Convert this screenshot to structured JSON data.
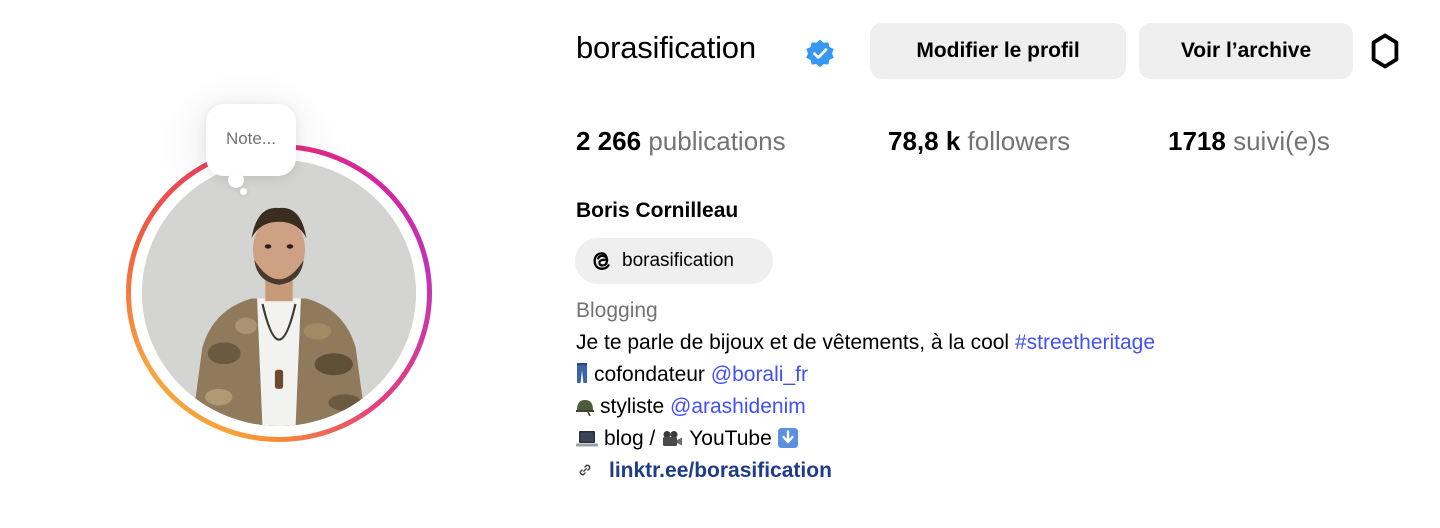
{
  "profile": {
    "username": "borasification",
    "verified": true,
    "note_placeholder": "Note...",
    "buttons": {
      "edit_profile": "Modifier le profil",
      "view_archive": "Voir l’archive"
    },
    "stats": {
      "posts_count": "2 266",
      "posts_label": "publications",
      "followers_count": "78,8 k",
      "followers_label": "followers",
      "following_count": "1718",
      "following_label": "suivi(e)s"
    },
    "full_name": "Boris Cornilleau",
    "threads_handle": "borasification",
    "category": "Blogging",
    "bio": {
      "line1_text": "Je te parle de bijoux et de vêtements, à la cool ",
      "line1_hashtag": "#streetheritage",
      "line2_text": "cofondateur ",
      "line2_mention": "@borali_fr",
      "line3_text": "styliste ",
      "line3_mention": "@arashidenim",
      "line4_text": "blog / ",
      "line4_text2": "YouTube "
    },
    "external_link": "linktr.ee/borasification"
  },
  "icons": {
    "verified": "verified-badge-icon",
    "settings": "gear-icon",
    "threads": "threads-icon",
    "link": "link-icon",
    "jeans_emoji": "jeans-emoji",
    "helmet_emoji": "military-helmet-emoji",
    "laptop_emoji": "laptop-emoji",
    "camera_emoji": "movie-camera-emoji",
    "down_arrow_emoji": "down-arrow-emoji"
  },
  "colors": {
    "link_blue": "#4150f7",
    "external_link": "#1f3c88",
    "verified_blue": "#3897f0",
    "button_bg": "#efefef",
    "secondary_text": "#737373"
  }
}
